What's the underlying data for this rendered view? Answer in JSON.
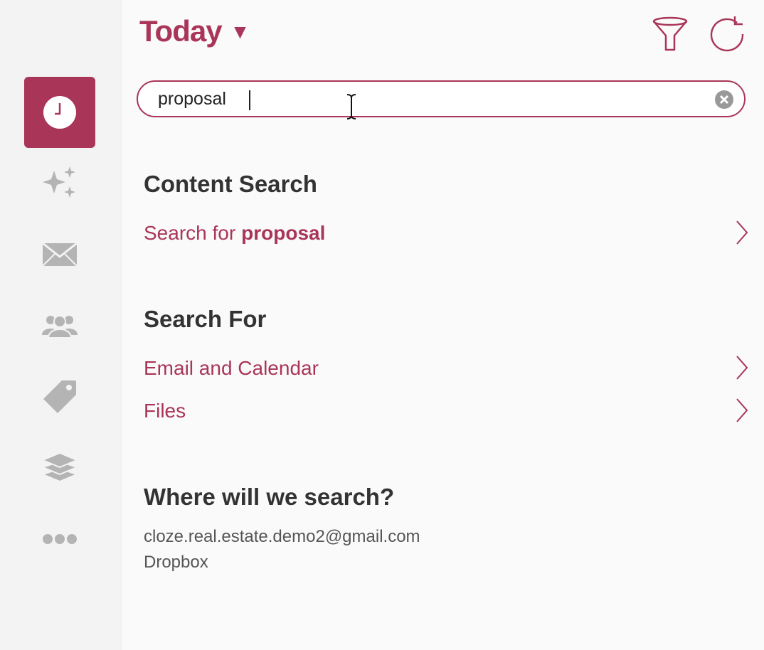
{
  "header": {
    "title": "Today",
    "caret": "▼"
  },
  "search": {
    "value": "proposal",
    "placeholder": ""
  },
  "content_search": {
    "heading": "Content Search",
    "row_prefix": "Search for",
    "row_term": "proposal"
  },
  "search_for": {
    "heading": "Search For",
    "items": [
      {
        "label": "Email and Calendar"
      },
      {
        "label": "Files"
      }
    ]
  },
  "where": {
    "heading": "Where will we search?",
    "sources": [
      "cloze.real.estate.demo2@gmail.com",
      "Dropbox"
    ]
  },
  "sidebar": {
    "items": [
      {
        "icon": "clock-icon",
        "active": true
      },
      {
        "icon": "sparkles-icon",
        "active": false
      },
      {
        "icon": "mail-icon",
        "active": false
      },
      {
        "icon": "people-icon",
        "active": false
      },
      {
        "icon": "tag-icon",
        "active": false
      },
      {
        "icon": "layers-icon",
        "active": false
      },
      {
        "icon": "more-icon",
        "active": false
      }
    ]
  },
  "colors": {
    "accent": "#a93558",
    "sidebar_bg": "#f3f3f3",
    "icon_gray": "#b4b4b4"
  }
}
